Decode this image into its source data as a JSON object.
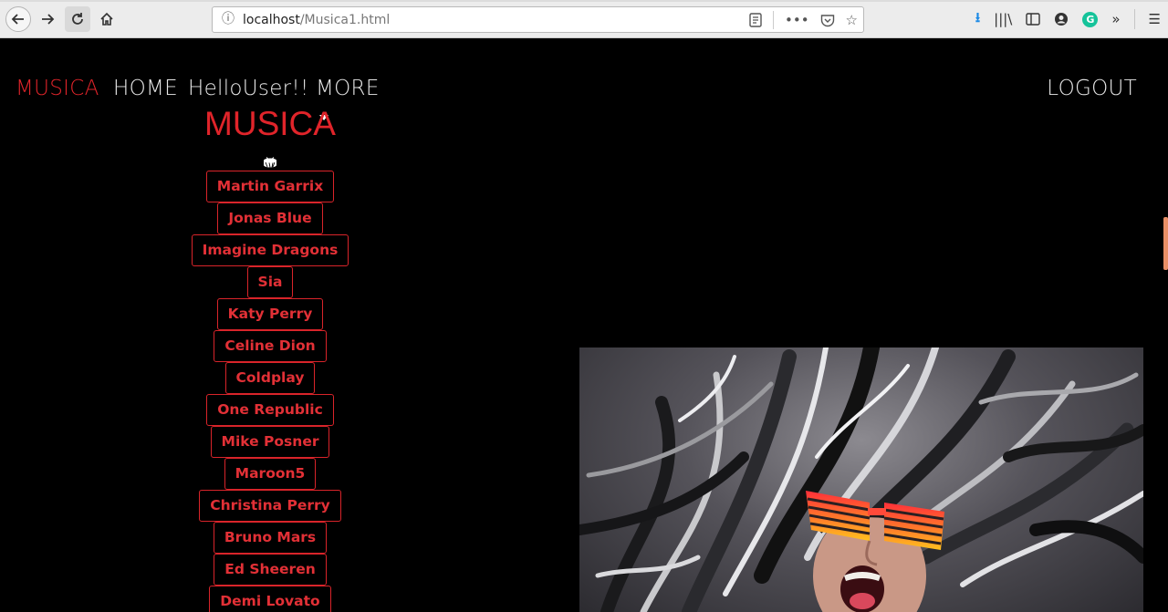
{
  "browser": {
    "url_host": "localhost",
    "url_path": "/Musica1.html",
    "icons": [
      "back-icon",
      "forward-icon",
      "reload-icon",
      "home-icon",
      "info-icon",
      "reader-view-icon",
      "more-actions-icon",
      "pocket-icon",
      "bookmark-star-icon",
      "download-icon",
      "library-icon",
      "sidebar-icon",
      "account-icon",
      "grammarly-icon",
      "overflow-icon",
      "menu-icon"
    ]
  },
  "nav": {
    "brand": "MUSICA",
    "home": "HOME",
    "user": "HelloUser!!",
    "more": "MORE",
    "logout": "LOGOUT"
  },
  "sidebar": {
    "title": "MUSICA",
    "artists": [
      "Martin Garrix",
      "Jonas Blue",
      "Imagine Dragons",
      "Sia",
      "Katy Perry",
      "Celine Dion",
      "Coldplay",
      "One Republic",
      "Mike Posner",
      "Maroon5",
      "Christina Perry",
      "Bruno Mars",
      "Ed Sheeren",
      "Demi Lovato"
    ]
  },
  "colors": {
    "accent": "#e0242a",
    "background": "#000000",
    "nav_text": "#e8e8e8",
    "scroll_thumb": "#e98f66"
  }
}
